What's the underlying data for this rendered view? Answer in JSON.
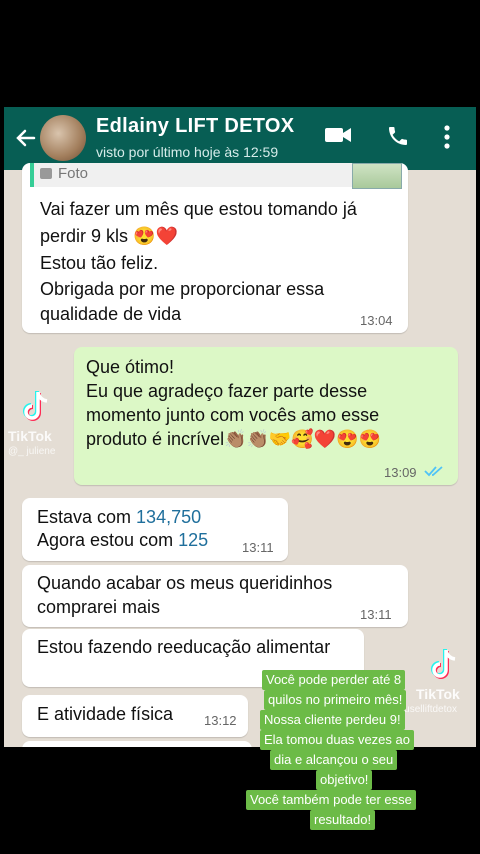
{
  "header": {
    "contact_name": "Edlainy LIFT DETOX",
    "status": "visto por último hoje às 12:59",
    "icons": [
      "back-arrow-icon",
      "video-call-icon",
      "phone-icon",
      "more-options-icon"
    ]
  },
  "messages": {
    "quoted_label": "Foto",
    "m1_line1": "Vai fazer um mês que estou tomando já",
    "m1_line2": "perdir 9 kls",
    "m1_line3": "Estou tão feliz.",
    "m1_line4": "Obrigada por me proporcionar essa",
    "m1_line5": "qualidade de vida",
    "m1_emojis": "😍❤️",
    "m1_time": "13:04",
    "m2_line1": "Que ótimo!",
    "m2_line2": "Eu que agradeço fazer parte desse",
    "m2_line3": "momento junto com vocês amo esse",
    "m2_line4": "produto é incrível",
    "m2_emojis": "👏🏽👏🏽🤝🥰❤️😍😍",
    "m2_time": "13:09",
    "m3_line1_prefix": "Estava com ",
    "m3_line1_number": "134,750",
    "m3_line2_prefix": "Agora estou com ",
    "m3_line2_number": "125",
    "m3_time": "13:11",
    "m4_line1": "Quando acabar os meus queridinhos",
    "m4_line2": "comprarei mais",
    "m4_time": "13:11",
    "m5_line1": "Estou fazendo reeducação alimentar",
    "m6_line1": "E atividade física",
    "m6_time": "13:12"
  },
  "watermarks": {
    "left_logo": "TikTok",
    "left_user": "@_ juliene",
    "right_logo": "TikTok",
    "right_user": "@uselliftdetox"
  },
  "overlay_caption": {
    "line1": "Você pode perder até 8",
    "line2": "quilos no primeiro mês!",
    "line3": "Nossa cliente perdeu 9!",
    "line4": "Ela tomou duas vezes ao",
    "line5": "dia e alcançou o seu",
    "line6": "objetivo!",
    "line7": "Você também pode ter esse",
    "line8": "resultado!"
  },
  "colors": {
    "header": "#075E54",
    "outgoing_bubble": "#DCF8C6",
    "incoming_bubble": "#FFFFFF",
    "overlay": "#6CBB47",
    "read_ticks": "#4FC3F7"
  }
}
